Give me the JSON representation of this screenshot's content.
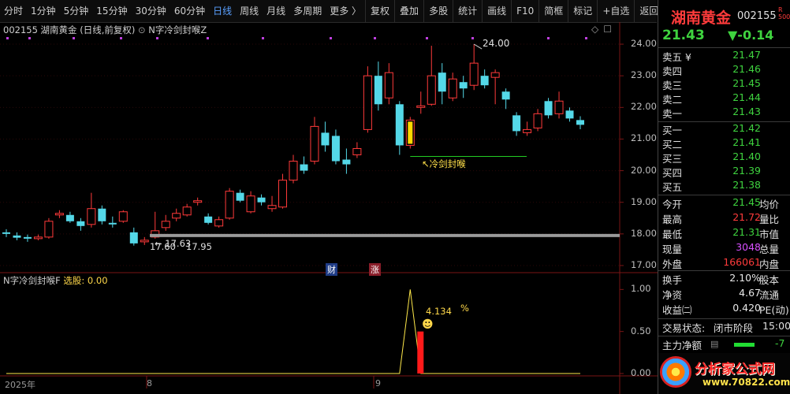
{
  "toolbar": {
    "periods": [
      "分时",
      "1分钟",
      "5分钟",
      "15分钟",
      "30分钟",
      "60分钟",
      "日线",
      "周线",
      "月线",
      "多周期",
      "更多 〉"
    ],
    "active_index": 6,
    "actions": [
      "复权",
      "叠加",
      "多股",
      "统计",
      "画线",
      "F10",
      "简框",
      "标记",
      "+自选",
      "返回"
    ]
  },
  "chart": {
    "header_stock": "002155 湖南黄金 (日线,前复权)",
    "header_indicator": "N字冷剑封喉Z",
    "y_ticks": [
      "24.00",
      "23.00",
      "22.00",
      "21.00",
      "20.00",
      "19.00",
      "18.00",
      "17.00"
    ],
    "max_label": "24.00",
    "min_label": "17.63",
    "low_line_label": "17.60",
    "low_line_value": "17.95",
    "signal_label": "冷剑封喉",
    "badge_cai": "财",
    "badge_zhang": "涨",
    "x_labels": [
      "2025年",
      "8",
      "9"
    ],
    "colors": {
      "up": "#ff3a3a",
      "down": "#54d8e8",
      "bg": "#000000",
      "axis": "#7a1515"
    }
  },
  "chart_data": {
    "type": "candlestick",
    "y_range": [
      16.8,
      24.4
    ],
    "candles": [
      [
        18.05,
        18.0,
        18.15,
        17.9
      ],
      [
        17.95,
        17.88,
        18.05,
        17.8
      ],
      [
        17.9,
        17.85,
        17.98,
        17.75
      ],
      [
        17.85,
        17.9,
        17.98,
        17.8
      ],
      [
        17.9,
        18.4,
        18.5,
        17.85
      ],
      [
        18.6,
        18.65,
        18.75,
        18.5
      ],
      [
        18.6,
        18.4,
        18.7,
        18.35
      ],
      [
        18.4,
        18.25,
        18.5,
        18.1
      ],
      [
        18.3,
        18.8,
        19.3,
        18.2
      ],
      [
        18.8,
        18.4,
        18.9,
        18.3
      ],
      [
        18.35,
        18.3,
        18.55,
        18.2
      ],
      [
        18.4,
        18.7,
        18.75,
        18.35
      ],
      [
        18.05,
        17.7,
        18.2,
        17.63
      ],
      [
        17.75,
        17.8,
        17.9,
        17.65
      ],
      [
        17.9,
        18.1,
        18.7,
        17.85
      ],
      [
        18.2,
        18.4,
        18.6,
        18.1
      ],
      [
        18.5,
        18.65,
        18.8,
        18.4
      ],
      [
        18.6,
        18.85,
        18.95,
        18.55
      ],
      [
        19.0,
        19.05,
        19.15,
        18.9
      ],
      [
        18.55,
        18.35,
        18.65,
        18.3
      ],
      [
        18.25,
        18.45,
        18.55,
        18.2
      ],
      [
        18.5,
        19.35,
        19.45,
        18.45
      ],
      [
        19.3,
        19.05,
        19.4,
        19.0
      ],
      [
        18.7,
        19.2,
        19.35,
        18.65
      ],
      [
        19.15,
        19.0,
        19.25,
        18.9
      ],
      [
        18.8,
        18.9,
        19.2,
        18.7
      ],
      [
        18.85,
        19.7,
        19.9,
        18.8
      ],
      [
        19.7,
        20.3,
        20.5,
        19.6
      ],
      [
        20.2,
        20.0,
        20.45,
        19.9
      ],
      [
        20.3,
        21.4,
        21.7,
        20.2
      ],
      [
        21.2,
        20.8,
        21.55,
        20.6
      ],
      [
        21.1,
        20.3,
        21.3,
        20.2
      ],
      [
        20.35,
        20.2,
        20.7,
        19.9
      ],
      [
        20.5,
        20.7,
        20.9,
        20.4
      ],
      [
        21.3,
        23.0,
        23.3,
        21.2
      ],
      [
        23.0,
        22.1,
        23.45,
        21.9
      ],
      [
        22.3,
        23.1,
        23.4,
        22.1
      ],
      [
        22.1,
        20.8,
        22.2,
        20.5
      ],
      [
        20.8,
        21.6,
        21.7,
        20.7
      ],
      [
        22.0,
        22.05,
        22.5,
        21.8
      ],
      [
        22.1,
        23.0,
        23.95,
        22.05
      ],
      [
        23.1,
        22.5,
        23.4,
        22.1
      ],
      [
        22.3,
        22.9,
        23.1,
        22.2
      ],
      [
        22.8,
        22.6,
        23.0,
        22.3
      ],
      [
        22.7,
        23.4,
        24.0,
        22.55
      ],
      [
        23.0,
        22.7,
        23.2,
        22.6
      ],
      [
        22.95,
        23.1,
        23.2,
        22.1
      ],
      [
        22.5,
        22.25,
        22.6,
        21.95
      ],
      [
        21.75,
        21.25,
        21.85,
        21.1
      ],
      [
        21.2,
        21.3,
        21.55,
        21.1
      ],
      [
        21.35,
        21.8,
        21.95,
        21.25
      ],
      [
        22.2,
        21.75,
        22.3,
        21.65
      ],
      [
        21.8,
        22.2,
        22.5,
        21.65
      ],
      [
        21.9,
        21.65,
        22.0,
        21.55
      ],
      [
        21.6,
        21.45,
        21.72,
        21.31
      ]
    ],
    "signal_index": 38,
    "sub_indicator": {
      "name": "N字冷剑封喉F",
      "metric_label": "选股:",
      "metric_value": "0.00",
      "y_ticks": [
        "1.00",
        "0.50",
        "0.00"
      ],
      "peak_label": "4.134",
      "peak_unit": "%",
      "y_range": [
        0,
        1.05
      ],
      "line": [
        0,
        0,
        0,
        0,
        0,
        0,
        0,
        0,
        0,
        0,
        0,
        0,
        0,
        0,
        0,
        0,
        0,
        0,
        0,
        0,
        0,
        0,
        0,
        0,
        0,
        0,
        0,
        0,
        0,
        0,
        0,
        0,
        0,
        0,
        0,
        0,
        0,
        0,
        1,
        0,
        0,
        0,
        0,
        0,
        0,
        0,
        0,
        0,
        0,
        0,
        0,
        0,
        0,
        0,
        0
      ]
    }
  },
  "panel": {
    "stock_name": "湖南黄金",
    "stock_code": "002155",
    "corner_label": "R\n500",
    "price": "21.43",
    "change": "▼-0.14",
    "asks": [
      [
        "卖五 ¥",
        "21.47"
      ],
      [
        "卖四",
        "21.46"
      ],
      [
        "卖三",
        "21.45"
      ],
      [
        "卖二",
        "21.44"
      ],
      [
        "卖一",
        "21.43"
      ]
    ],
    "bids": [
      [
        "买一",
        "21.42"
      ],
      [
        "买二",
        "21.41"
      ],
      [
        "买三",
        "21.40"
      ],
      [
        "买四",
        "21.39"
      ],
      [
        "买五",
        "21.38"
      ]
    ],
    "stats": [
      {
        "label": "今开",
        "value": "21.45",
        "color": "green",
        "label2": "均价"
      },
      {
        "label": "最高",
        "value": "21.72",
        "color": "red",
        "label2": "量比"
      },
      {
        "label": "最低",
        "value": "21.31",
        "color": "green",
        "label2": "市值"
      },
      {
        "label": "现量",
        "value": "3048",
        "color": "purple",
        "label2": "总量"
      },
      {
        "label": "外盘",
        "value": "166061",
        "color": "red",
        "label2": "内盘"
      }
    ],
    "stats2": [
      {
        "label": "换手",
        "value": "2.10%",
        "label2": "股本"
      },
      {
        "label": "净资",
        "value": "4.67",
        "label2": "流通"
      },
      {
        "label": "收益㈡",
        "value": "0.420",
        "label2": "PE(动)"
      }
    ],
    "trade_status_label": "交易状态:",
    "trade_status_value": "闭市阶段",
    "trade_time": "15:00",
    "main_flow_label": "主力净额",
    "main_flow_value": "-7",
    "watermark_text": "分析家公式网",
    "watermark_url": "www.70822.com"
  }
}
